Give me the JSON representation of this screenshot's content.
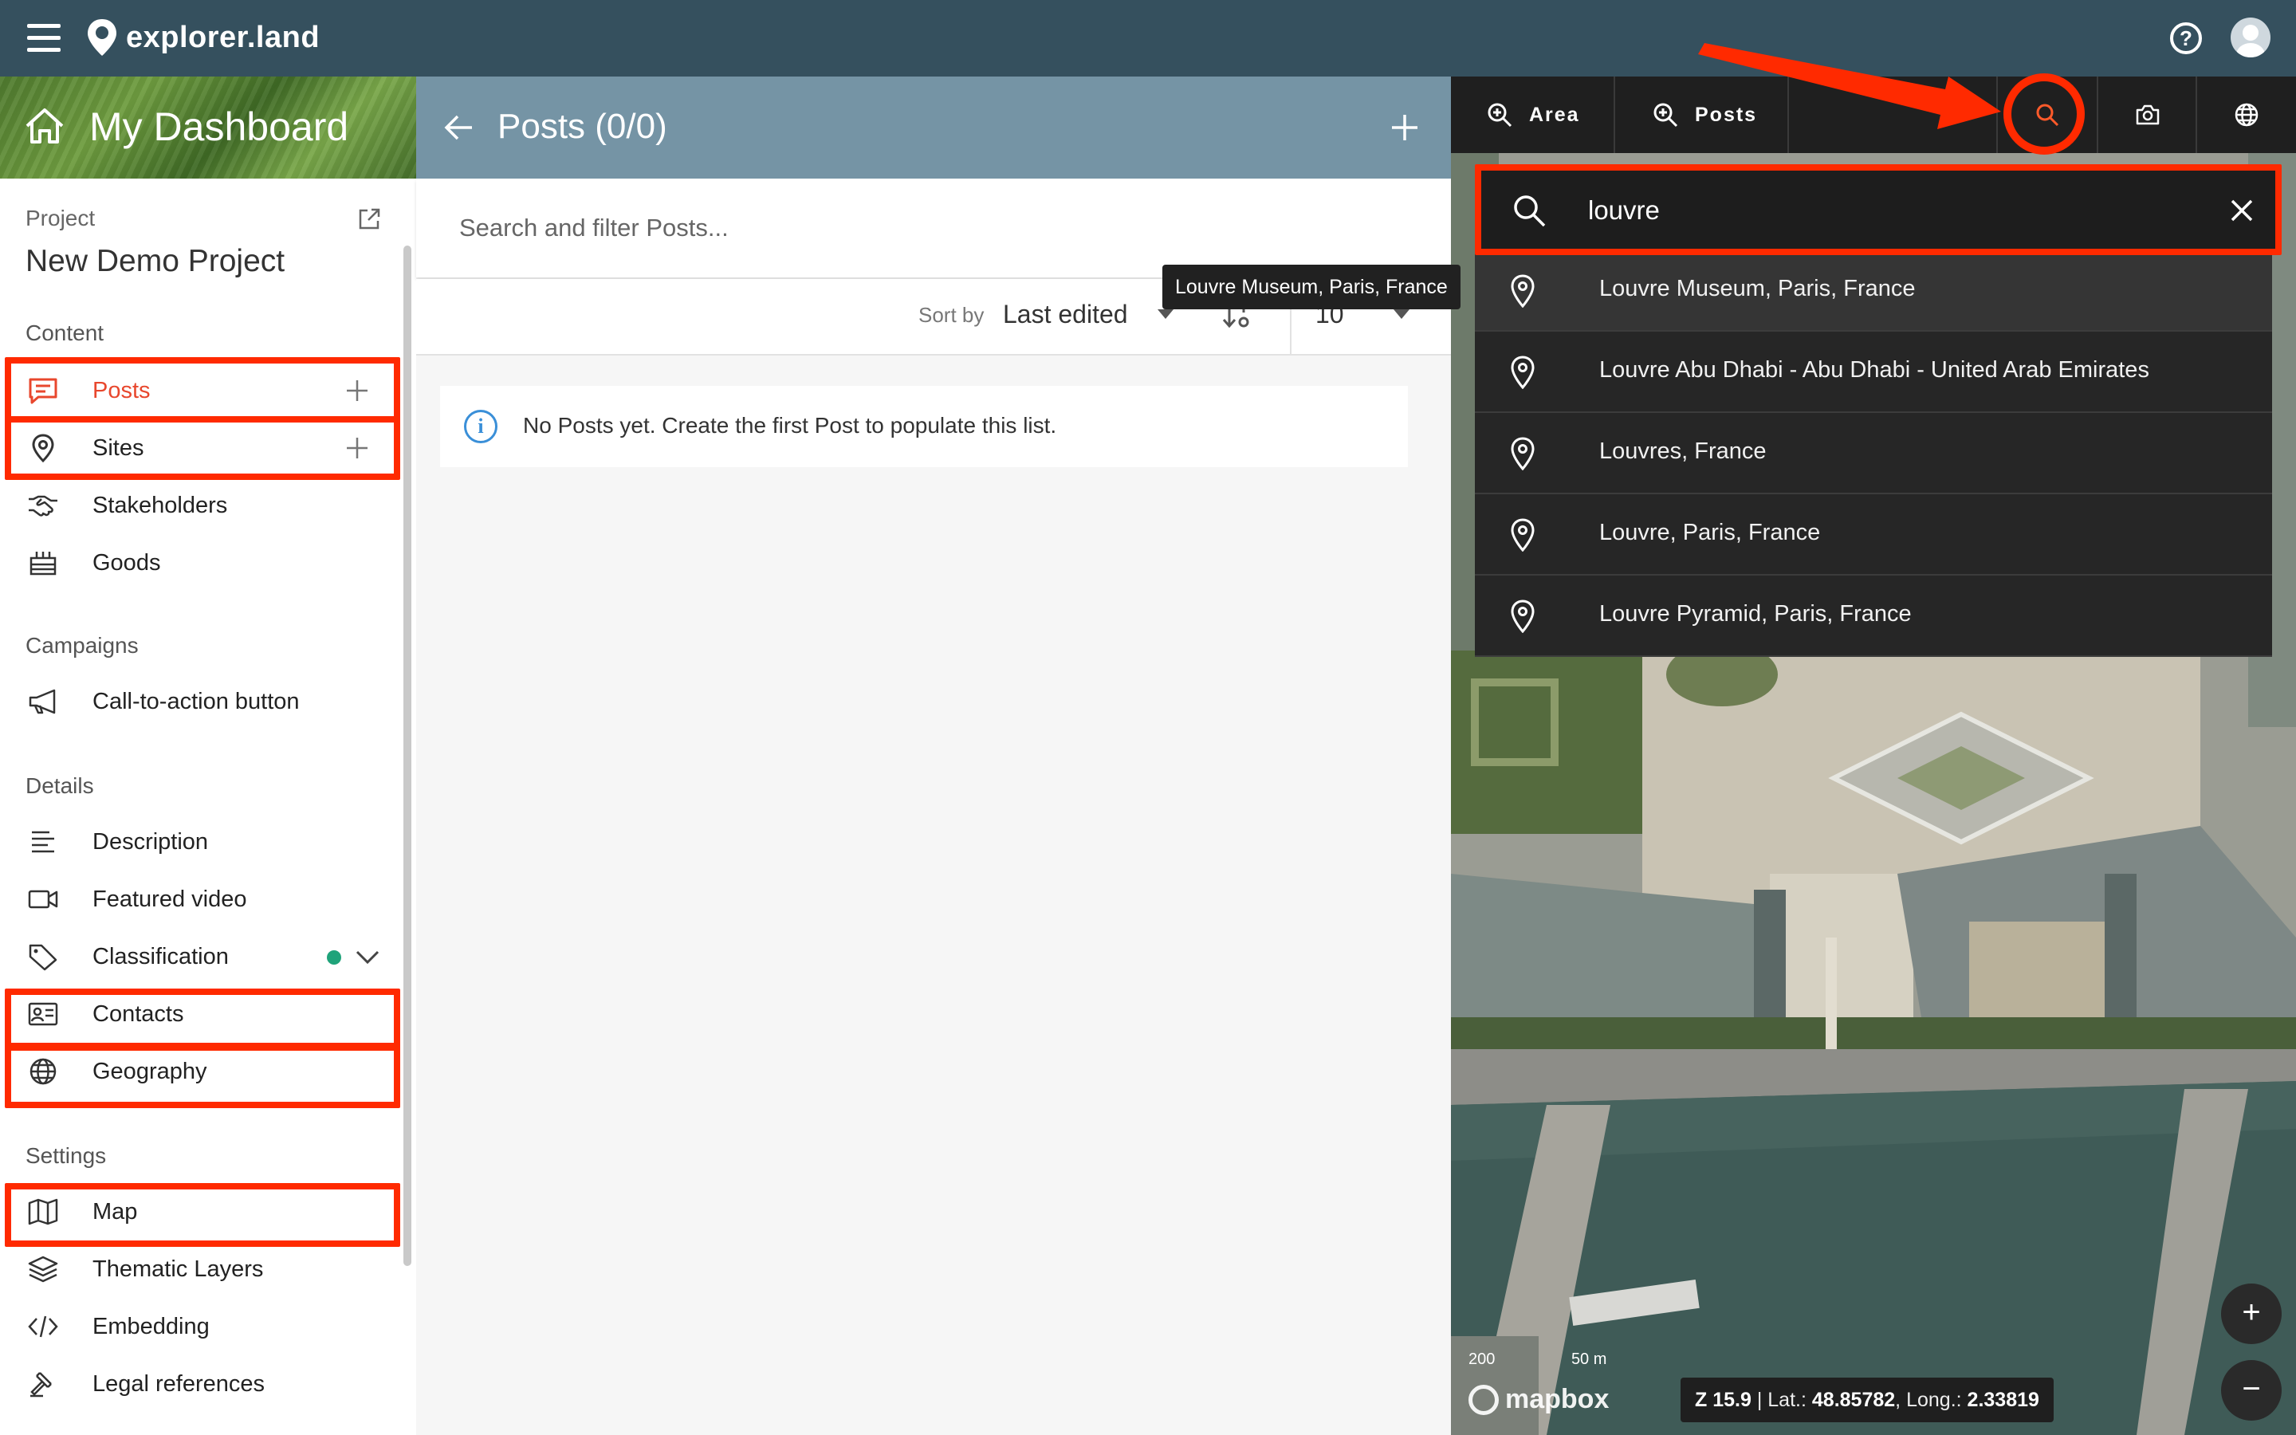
{
  "app": {
    "name": "explorer.land"
  },
  "sidebar": {
    "dashboard_title": "My Dashboard",
    "project_label": "Project",
    "project_name": "New Demo Project",
    "sections": {
      "content": "Content",
      "campaigns": "Campaigns",
      "details": "Details",
      "settings": "Settings"
    },
    "items": {
      "posts": "Posts",
      "sites": "Sites",
      "stakeholders": "Stakeholders",
      "goods": "Goods",
      "cta": "Call-to-action button",
      "description": "Description",
      "featured_video": "Featured video",
      "classification": "Classification",
      "contacts": "Contacts",
      "geography": "Geography",
      "map": "Map",
      "thematic_layers": "Thematic Layers",
      "embedding": "Embedding",
      "legal_references": "Legal references"
    }
  },
  "posts_panel": {
    "title": "Posts (0/0)",
    "search_placeholder": "Search and filter Posts...",
    "sort_label": "Sort by",
    "sort_value": "Last edited",
    "per_page": "10",
    "empty_message": "No Posts yet. Create the first Post to populate this list.",
    "tooltip": "Louvre Museum, Paris, France"
  },
  "map_panel": {
    "toolbar": {
      "area_label": "Area",
      "posts_label": "Posts"
    },
    "search_value": "louvre",
    "results": [
      "Louvre Museum, Paris, France",
      "Louvre Abu Dhabi - Abu Dhabi - United Arab Emirates",
      "Louvres, France",
      "Louvre, Paris, France",
      "Louvre Pyramid, Paris, France"
    ],
    "status": {
      "zoom": "Z 15.9",
      "lat_label": "Lat.:",
      "lat": "48.85782",
      "long_label": "Long.:",
      "long": "2.33819"
    },
    "scale_left": "200",
    "scale_right": "50 m",
    "attribution": "mapbox",
    "zoom_in": "+",
    "zoom_out": "−"
  },
  "colors": {
    "topbar": "#35505e",
    "posts_header": "#7594a5",
    "accent_orange": "#e8472d",
    "annotation_red": "#ff2a00",
    "status_green": "#1fa37a"
  }
}
